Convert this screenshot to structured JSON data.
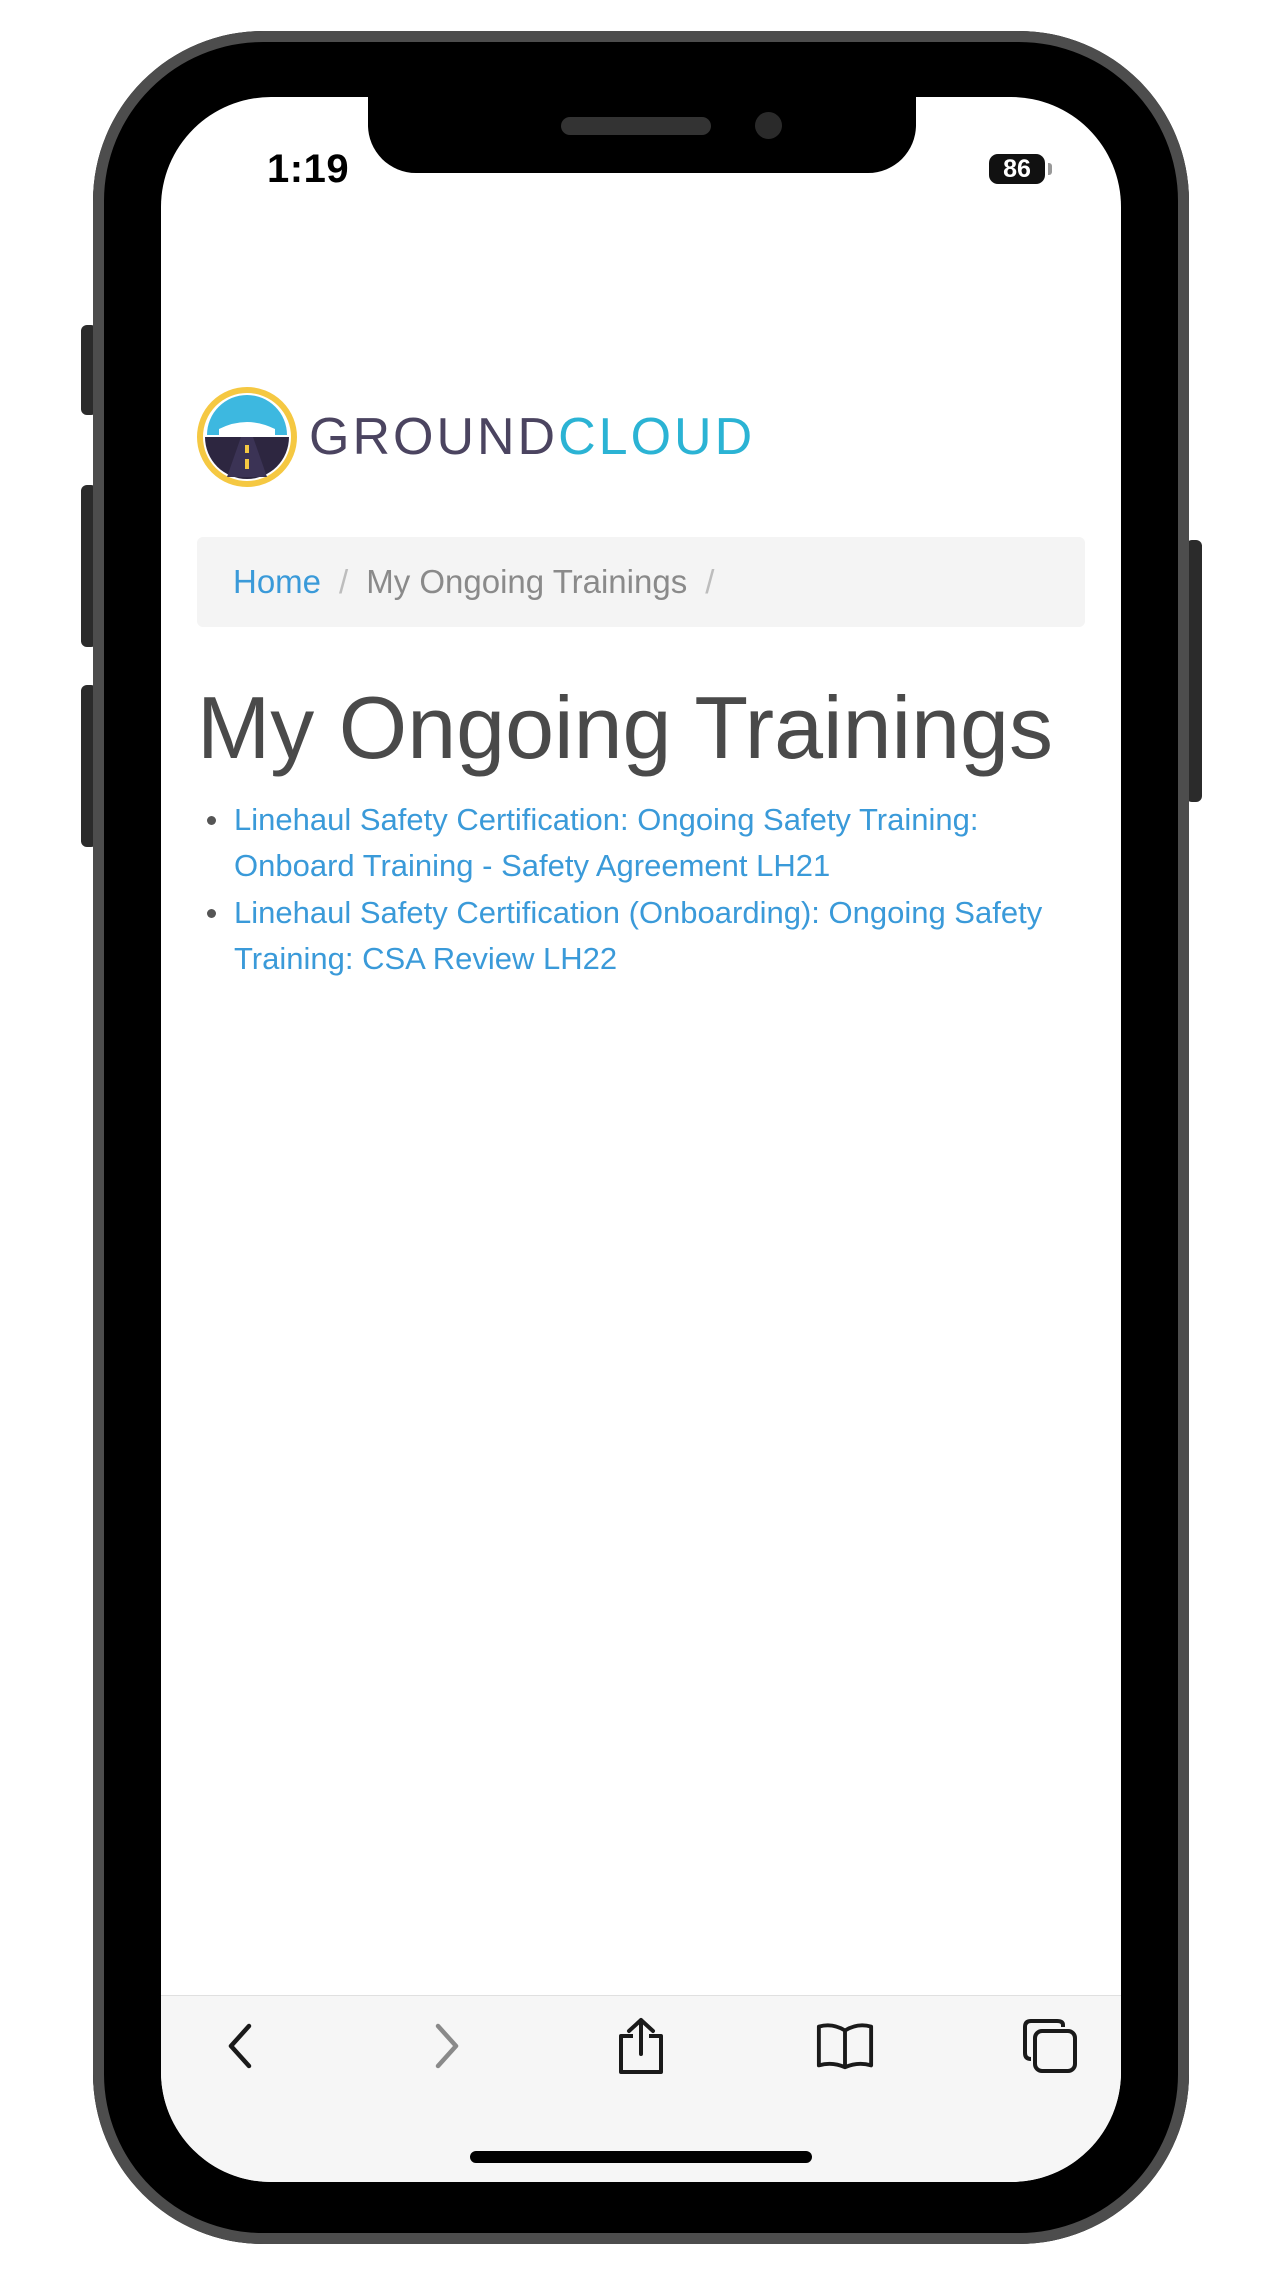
{
  "status_bar": {
    "time": "1:19",
    "battery": "86"
  },
  "logo": {
    "text_part1": "GROUND",
    "text_part2": "CLOUD",
    "colors": {
      "ground": "#4b4460",
      "cloud": "#2bb3d4",
      "ring": "#f5c842",
      "sky": "#3db8e0"
    }
  },
  "breadcrumb": {
    "items": [
      {
        "label": "Home"
      },
      {
        "label": "My Ongoing Trainings"
      }
    ],
    "separator": "/"
  },
  "page": {
    "title": "My Ongoing Trainings",
    "trainings": [
      {
        "label": "Linehaul Safety Certification: Ongoing Safety Training: Onboard Training - Safety Agreement LH21"
      },
      {
        "label": "Linehaul Safety Certification (Onboarding): Ongoing Safety Training: CSA Review LH22"
      }
    ]
  },
  "toolbar": {
    "icons": [
      "back-icon",
      "forward-icon",
      "share-icon",
      "bookmarks-icon",
      "tabs-icon"
    ]
  }
}
